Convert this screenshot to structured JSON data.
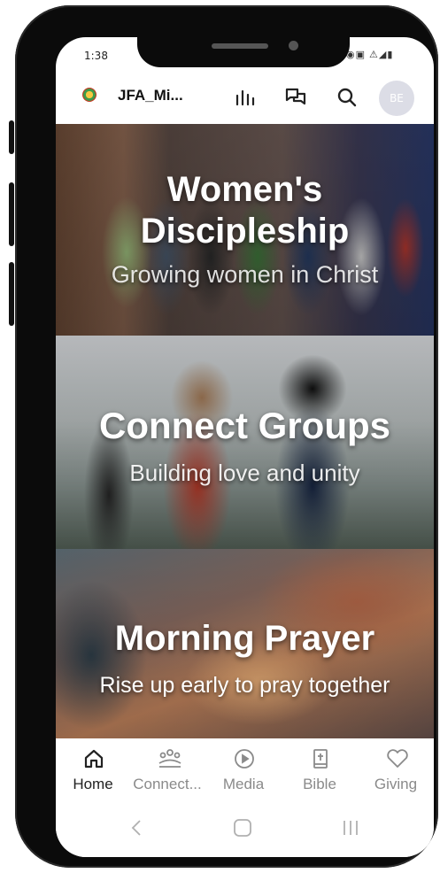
{
  "status_bar": {
    "time": "1:38",
    "icons": "◉▣  ⚠◢▮"
  },
  "header": {
    "title": "JFA_Mi...",
    "avatar_initials": "BE"
  },
  "cards": [
    {
      "title_line1": "Women's",
      "title_line2": "Discipleship",
      "subtitle": "Growing women in Christ"
    },
    {
      "title": "Connect Groups",
      "subtitle": "Building love and unity"
    },
    {
      "title": "Morning Prayer",
      "subtitle": "Rise up early to pray together"
    }
  ],
  "bottom_nav": [
    {
      "label": "Home",
      "icon": "home-icon",
      "active": true
    },
    {
      "label": "Connect...",
      "icon": "people-icon"
    },
    {
      "label": "Media",
      "icon": "play-circle-icon"
    },
    {
      "label": "Bible",
      "icon": "bible-icon"
    },
    {
      "label": "Giving",
      "icon": "heart-icon"
    }
  ],
  "colors": {
    "accent_text": "#222222",
    "inactive_text": "#8a8a8a",
    "avatar_bg": "#dcdde6"
  }
}
